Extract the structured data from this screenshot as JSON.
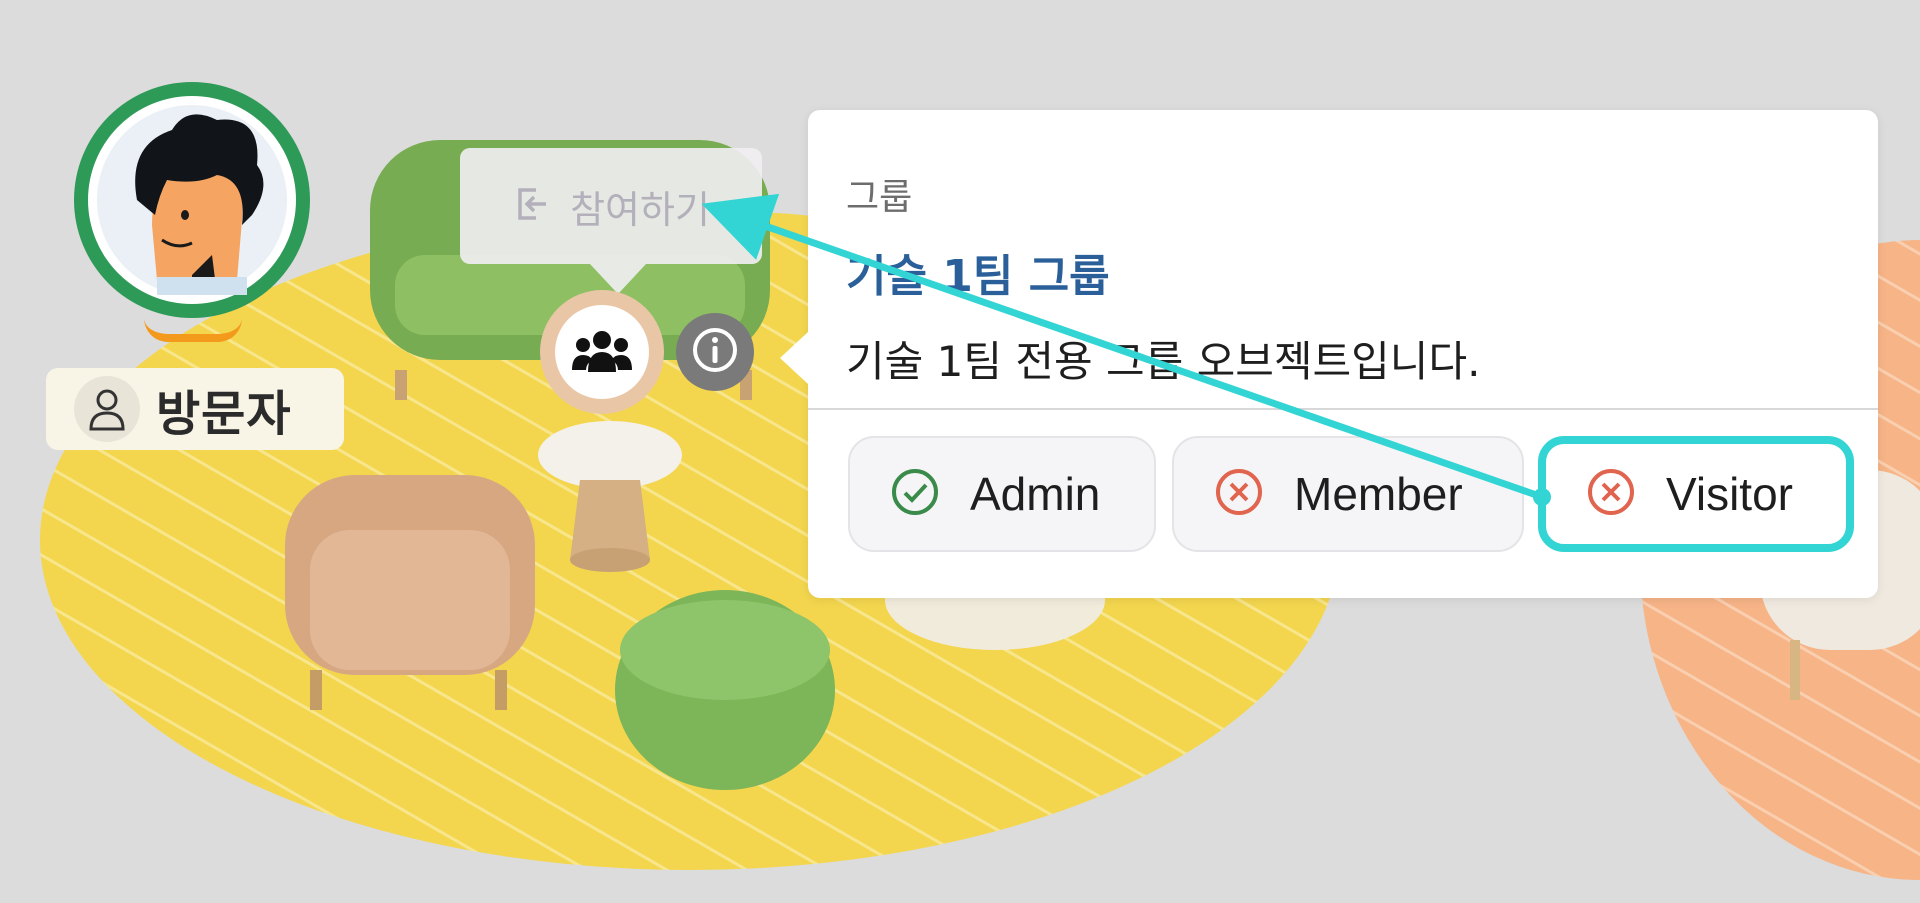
{
  "user": {
    "name": "방문자",
    "colors": {
      "ring": "#2e9a58",
      "underline": "#f39a1d"
    },
    "avatar_icon": "person-avatar",
    "role_icon": "user-outline-icon"
  },
  "join_tooltip": {
    "label": "참여하기",
    "icon": "enter-icon"
  },
  "group_object": {
    "icon": "group-icon",
    "info_icon": "info-icon"
  },
  "popover": {
    "category": "그룹",
    "title": "기술 1팀 그룹",
    "description": "기술 1팀 전용 그룹 오브젝트입니다.",
    "roles": [
      {
        "label": "Admin",
        "status": "allowed",
        "icon": "check-circle-icon",
        "color": "#3a8a4a"
      },
      {
        "label": "Member",
        "status": "denied",
        "icon": "x-circle-icon",
        "color": "#e0644e"
      },
      {
        "label": "Visitor",
        "status": "denied",
        "icon": "x-circle-icon",
        "color": "#e0644e",
        "highlighted": true
      }
    ],
    "highlight_color": "#33d4d4"
  }
}
